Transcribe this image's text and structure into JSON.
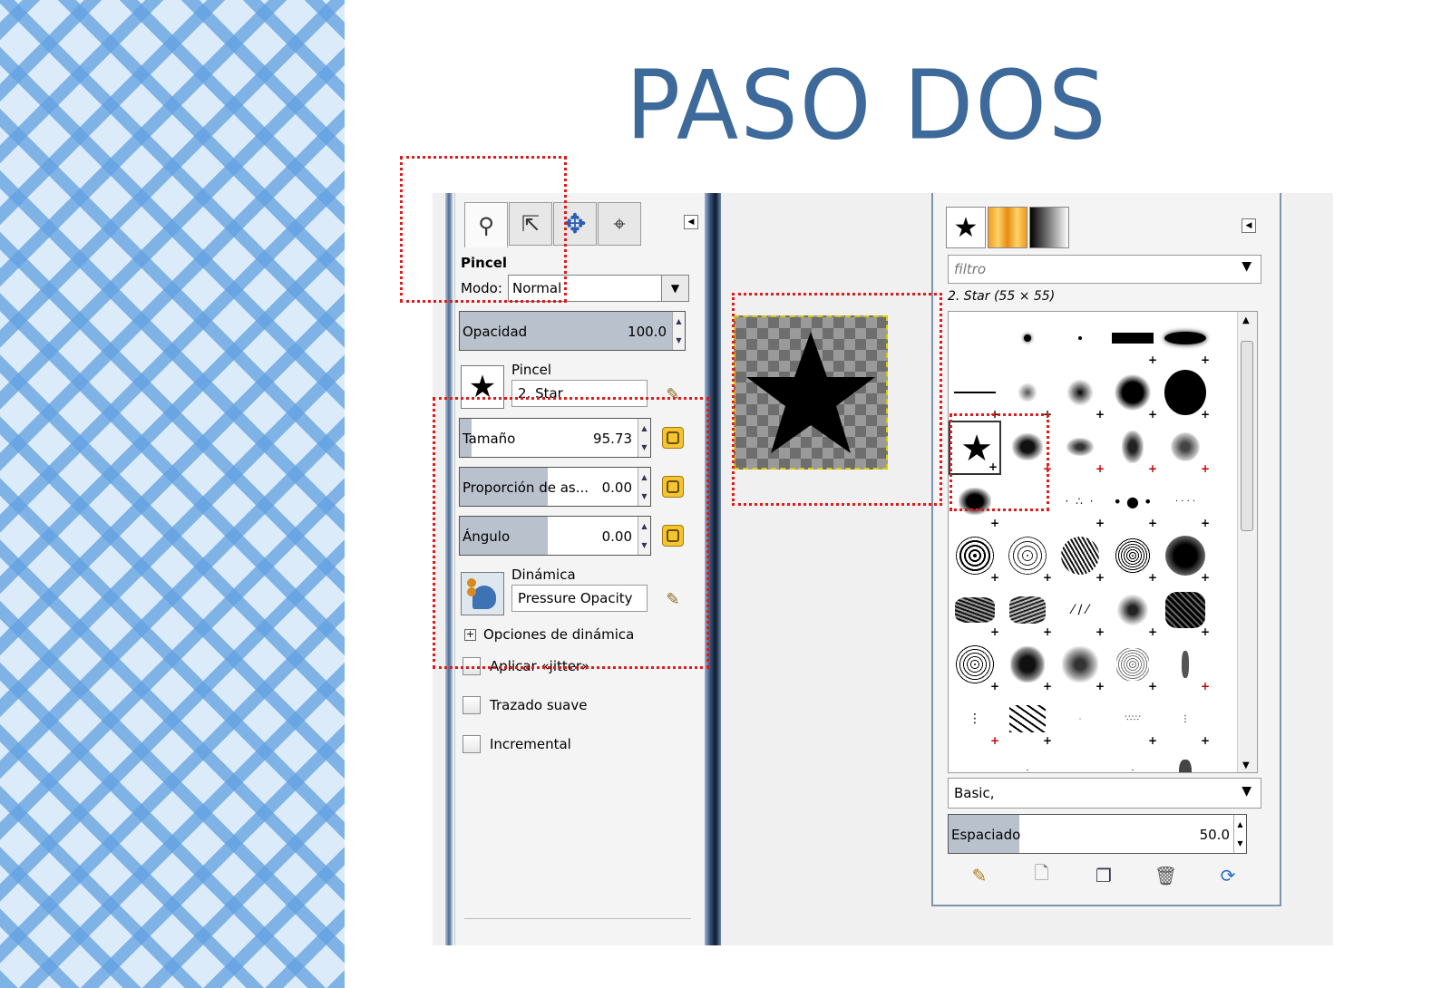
{
  "title": "PASO DOS",
  "tool_options": {
    "tool_name": "Pincel",
    "mode_label": "Modo:",
    "mode_value": "Normal",
    "opacity_label": "Opacidad",
    "opacity_value": "100.0",
    "brush_section_label": "Pincel",
    "brush_value": "2. Star",
    "size_label": "Tamaño",
    "size_value": "95.73",
    "aspect_label": "Proporción de as...",
    "aspect_value": "0.00",
    "angle_label": "Ángulo",
    "angle_value": "0.00",
    "dynamics_label": "Dinámica",
    "dynamics_value": "Pressure Opacity",
    "dynamics_options_label": "Opciones de dinámica",
    "checkboxes": [
      {
        "label": "Aplicar «jitter»",
        "checked": false
      },
      {
        "label": "Trazado suave",
        "checked": false
      },
      {
        "label": "Incremental",
        "checked": false
      }
    ],
    "tabs": [
      "tool-options-icon",
      "pointer-icon",
      "move-icon",
      "navigate-icon"
    ]
  },
  "brushes_panel": {
    "filter_placeholder": "filtro",
    "selected_brush": "2. Star (55 × 55)",
    "tag_combo": "Basic,",
    "spacing_label": "Espaciado",
    "spacing_value": "50.0",
    "tabs": [
      "brushes-icon",
      "patterns-icon",
      "gradients-icon"
    ],
    "actions": [
      "edit-brush-icon",
      "new-brush-icon",
      "duplicate-brush-icon",
      "delete-brush-icon",
      "refresh-brushes-icon"
    ]
  },
  "colors": {
    "title": "#3d6a9a",
    "highlight": "#e01b1b",
    "slider_fill": "#b9c2cc"
  }
}
